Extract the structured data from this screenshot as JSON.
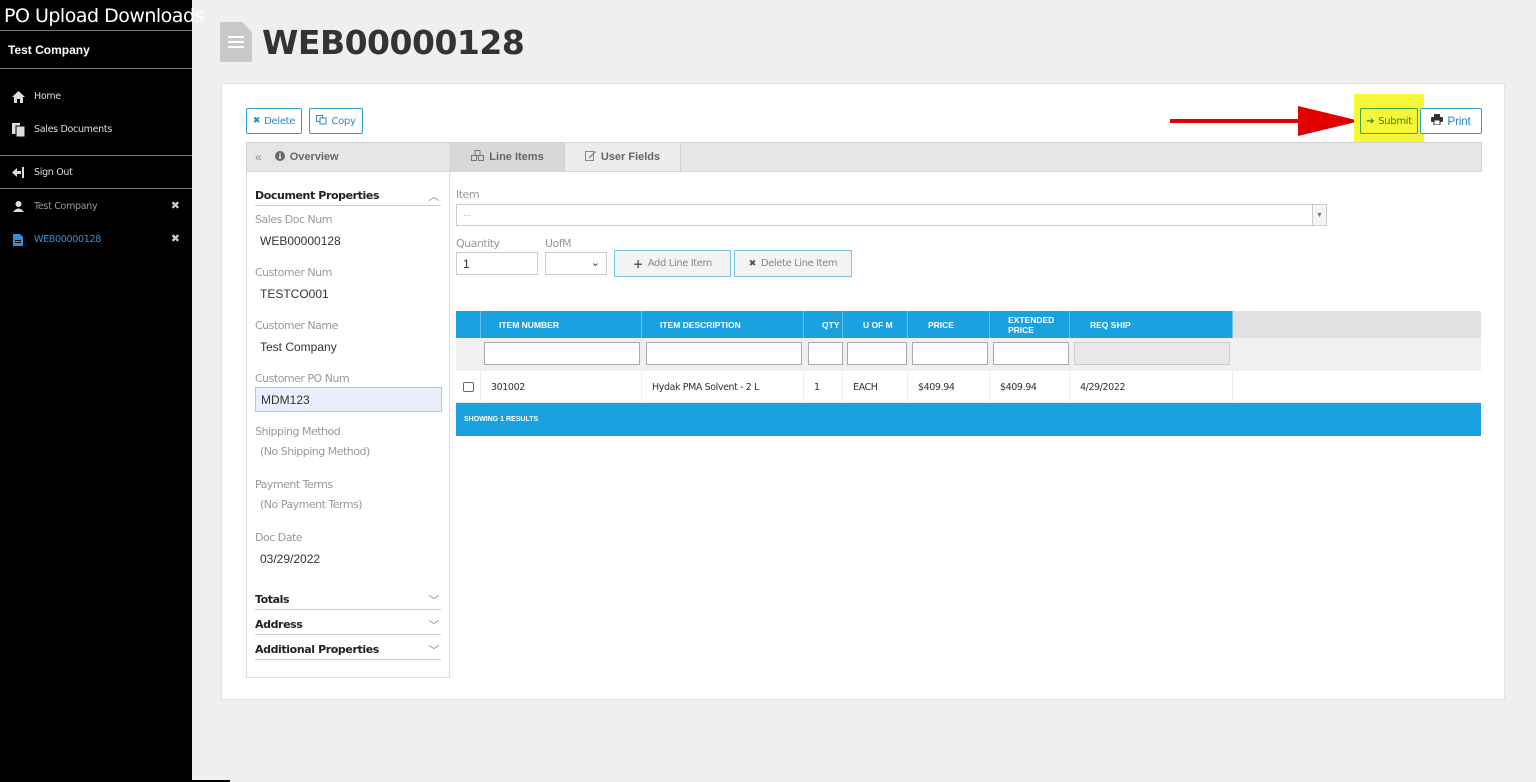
{
  "sidebar": {
    "app_title": "PO Upload  Downloads",
    "company": "Test Company",
    "nav": [
      {
        "label": "Home",
        "icon": "home-icon"
      },
      {
        "label": "Sales Documents",
        "icon": "documents-icon"
      }
    ],
    "sign_out": "Sign Out",
    "open_tabs": [
      {
        "label": "Test Company",
        "icon": "user-icon",
        "active": false
      },
      {
        "label": "WEB00000128",
        "icon": "file-icon",
        "active": true
      }
    ],
    "close_glyph": "✖"
  },
  "header": {
    "title": "WEB00000128"
  },
  "toolbar": {
    "delete_label": "Delete",
    "copy_label": "Copy",
    "submit_label": "Submit",
    "print_label": "Print"
  },
  "tabs": {
    "overview": "Overview",
    "line_items": "Line Items",
    "user_fields": "User Fields"
  },
  "document_properties": {
    "heading": "Document Properties",
    "fields": [
      {
        "label": "Sales Doc Num",
        "value": "WEB00000128"
      },
      {
        "label": "Customer Num",
        "value": "TESTCO001"
      },
      {
        "label": "Customer Name",
        "value": "Test Company"
      },
      {
        "label": "Customer PO Num",
        "value": "MDM123"
      },
      {
        "label": "Shipping Method",
        "value": "(No Shipping Method)"
      },
      {
        "label": "Payment Terms",
        "value": "(No Payment Terms)"
      },
      {
        "label": "Doc Date",
        "value": "03/29/2022"
      }
    ],
    "sections": [
      "Totals",
      "Address",
      "Additional Properties"
    ]
  },
  "line_entry": {
    "item_label": "Item",
    "item_value": "...",
    "quantity_label": "Quantity",
    "quantity_value": "1",
    "uofm_label": "UofM",
    "add_label": "Add Line Item",
    "delete_label": "Delete Line Item"
  },
  "grid": {
    "columns": [
      "ITEM NUMBER",
      "ITEM DESCRIPTION",
      "QTY",
      "U OF M",
      "PRICE",
      "EXTENDED PRICE",
      "REQ SHIP"
    ],
    "rows": [
      [
        "301002",
        "Hydak PMA Solvent - 2 L",
        "1",
        "EACH",
        "$409.94",
        "$409.94",
        "4/29/2022"
      ]
    ],
    "footer": "SHOWING 1 RESULTS"
  },
  "colors": {
    "accent": "#1aa1e0",
    "highlight": "#f7f73a",
    "arrow": "#e10000"
  }
}
